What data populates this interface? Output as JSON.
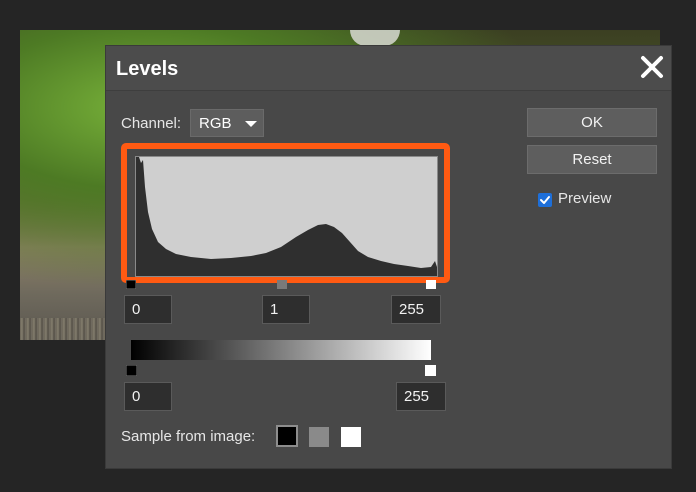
{
  "dialog": {
    "title": "Levels"
  },
  "channel": {
    "label": "Channel:",
    "selected": "RGB"
  },
  "input_levels": {
    "shadow": "0",
    "midtone": "1",
    "highlight": "255"
  },
  "output_levels": {
    "shadow": "0",
    "highlight": "255"
  },
  "buttons": {
    "ok": "OK",
    "reset": "Reset"
  },
  "preview": {
    "label": "Preview",
    "checked": true
  },
  "sample": {
    "label": "Sample from image:"
  },
  "icons": {
    "close": "close-icon",
    "dropdown": "chevron-down-icon",
    "check": "checkmark-icon",
    "eyedropper_black": "black-point-swatch",
    "eyedropper_gray": "gray-point-swatch",
    "eyedropper_white": "white-point-swatch"
  },
  "colors": {
    "highlight_box": "#ff5a12",
    "checkbox": "#1e6fd9",
    "dialog_bg": "#484848",
    "histogram_bg": "#cfcfcf",
    "histogram_fill": "#2f2f2f"
  }
}
